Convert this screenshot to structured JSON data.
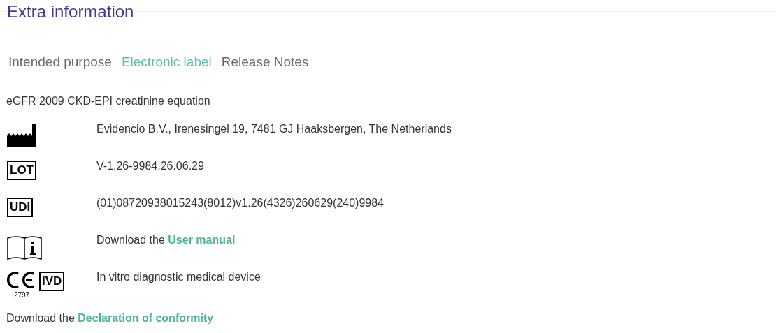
{
  "section_title": "Extra information",
  "tabs": [
    {
      "label": "Intended purpose",
      "selected": false
    },
    {
      "label": "Electronic label",
      "selected": true
    },
    {
      "label": "Release Notes",
      "selected": false
    }
  ],
  "device_name": "eGFR 2009 CKD-EPI creatinine equation",
  "label_rows": [
    {
      "kind": "manufacturer",
      "text": "Evidencio B.V., Irenesingel 19, 7481 GJ Haaksbergen, The Netherlands"
    },
    {
      "kind": "lot",
      "symbol": "LOT",
      "text": "V-1.26-9984.26.06.29"
    },
    {
      "kind": "udi",
      "symbol": "UDI",
      "text": "(01)08720938015243(8012)v1.26(4326)260629(240)9984"
    },
    {
      "kind": "manual",
      "text": "Download the ",
      "link": "User manual"
    },
    {
      "kind": "ce",
      "symbol": "IVD",
      "notified_body": "2797",
      "text": "In vitro diagnostic medical device"
    }
  ],
  "declaration": {
    "text": "Download the ",
    "link": "Declaration of conformity"
  }
}
